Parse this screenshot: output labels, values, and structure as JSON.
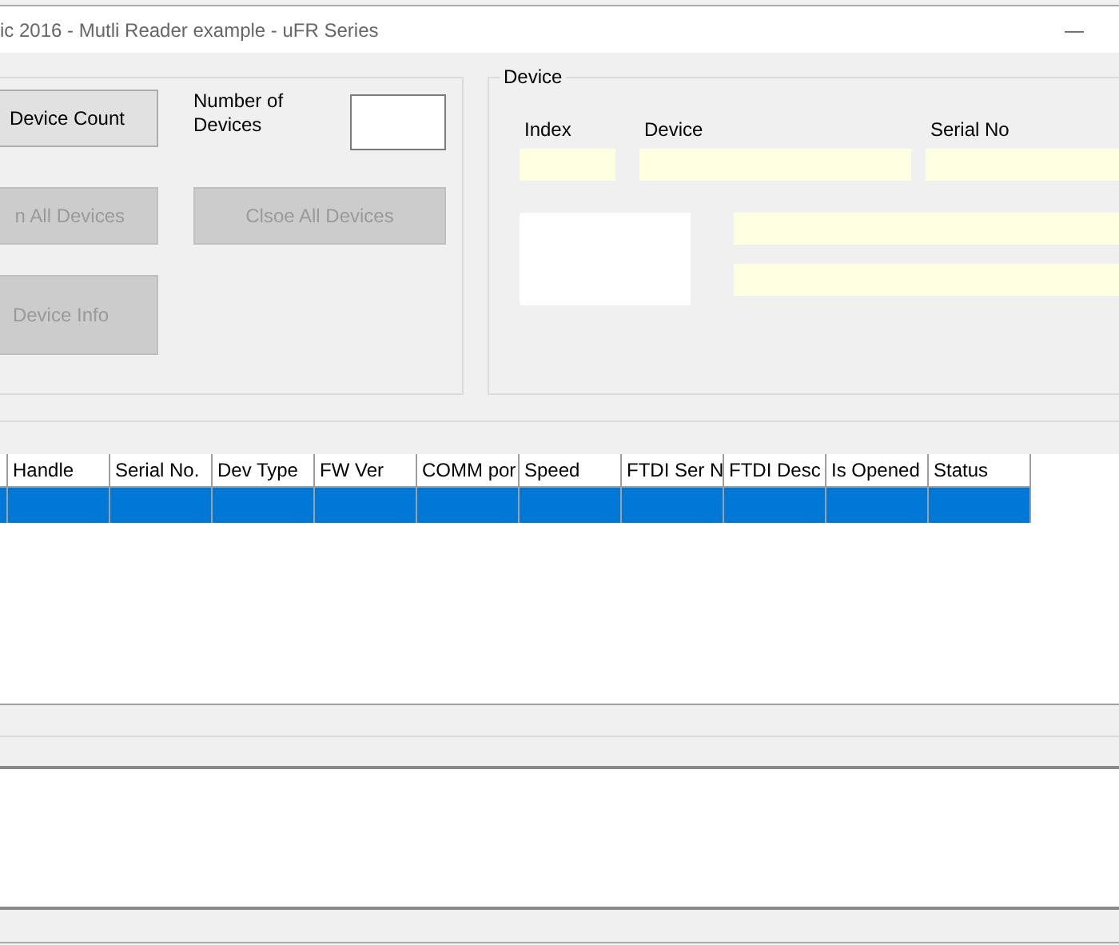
{
  "window": {
    "title": "ic 2016 - Mutli Reader example - uFR Series",
    "minimize": "—"
  },
  "controls": {
    "buttons": [
      {
        "label": "Device Count",
        "disabled": false
      },
      {
        "label": "n All Devices",
        "disabled": true
      },
      {
        "label": "Clsoe All Devices",
        "disabled": true
      },
      {
        "label": "Device Info",
        "disabled": true
      }
    ],
    "count_label": "Number of Devices"
  },
  "device": {
    "legend": "Device",
    "labels": [
      "Index",
      "Device",
      "Serial No"
    ]
  },
  "grid": {
    "columns": [
      "",
      "Handle",
      "Serial No.",
      "Dev Type",
      "FW Ver",
      "COMM por",
      "Speed",
      "FTDI Ser N",
      "FTDI Desc",
      "Is Opened",
      "Status"
    ],
    "rows": [
      {
        "selected": true
      }
    ]
  }
}
